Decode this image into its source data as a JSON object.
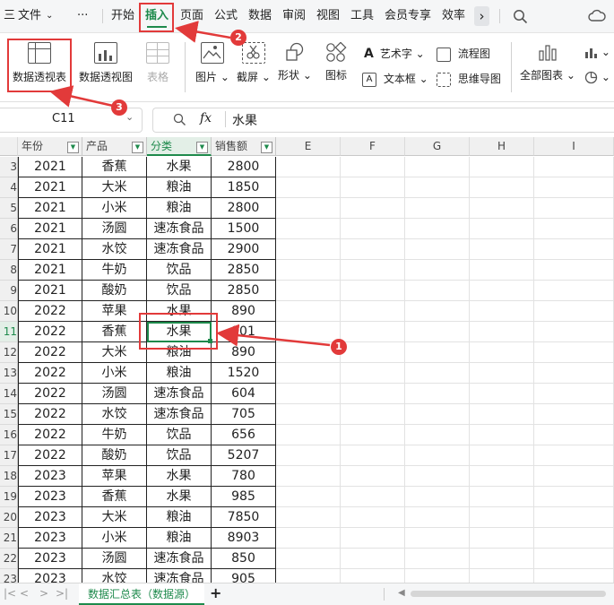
{
  "menu": {
    "hamburger": "三",
    "file": "文件",
    "file_caret": "⌄",
    "more": "···",
    "tabs": [
      "开始",
      "插入",
      "页面",
      "公式",
      "数据",
      "审阅",
      "视图",
      "工具",
      "会员专享",
      "效率"
    ],
    "next_arrow": "›"
  },
  "ribbon": {
    "pivot_table": "数据透视表",
    "pivot_chart": "数据透视图",
    "table": "表格",
    "picture": "图片",
    "screenshot": "截屏",
    "shape": "形状",
    "icon": "图标",
    "wordart": "艺术字",
    "textbox": "文本框",
    "flowchart": "流程图",
    "mindmap": "思维导图",
    "all_charts": "全部图表"
  },
  "formula_bar": {
    "cell_ref": "C11",
    "fx": "fx",
    "value": "水果"
  },
  "columns": {
    "a": "年份",
    "b": "产品",
    "c": "分类",
    "d": "销售额",
    "e": "E",
    "f": "F",
    "g": "G",
    "h": "H",
    "i": "I"
  },
  "rows": [
    {
      "num": "3",
      "year": "2021",
      "product": "香蕉",
      "category": "水果",
      "sales": "2800"
    },
    {
      "num": "4",
      "year": "2021",
      "product": "大米",
      "category": "粮油",
      "sales": "1850"
    },
    {
      "num": "5",
      "year": "2021",
      "product": "小米",
      "category": "粮油",
      "sales": "2800"
    },
    {
      "num": "6",
      "year": "2021",
      "product": "汤圆",
      "category": "速冻食品",
      "sales": "1500"
    },
    {
      "num": "7",
      "year": "2021",
      "product": "水饺",
      "category": "速冻食品",
      "sales": "2900"
    },
    {
      "num": "8",
      "year": "2021",
      "product": "牛奶",
      "category": "饮品",
      "sales": "2850"
    },
    {
      "num": "9",
      "year": "2021",
      "product": "酸奶",
      "category": "饮品",
      "sales": "2850"
    },
    {
      "num": "10",
      "year": "2022",
      "product": "苹果",
      "category": "水果",
      "sales": "890"
    },
    {
      "num": "11",
      "year": "2022",
      "product": "香蕉",
      "category": "水果",
      "sales": "901"
    },
    {
      "num": "12",
      "year": "2022",
      "product": "大米",
      "category": "粮油",
      "sales": "890"
    },
    {
      "num": "13",
      "year": "2022",
      "product": "小米",
      "category": "粮油",
      "sales": "1520"
    },
    {
      "num": "14",
      "year": "2022",
      "product": "汤圆",
      "category": "速冻食品",
      "sales": "604"
    },
    {
      "num": "15",
      "year": "2022",
      "product": "水饺",
      "category": "速冻食品",
      "sales": "705"
    },
    {
      "num": "16",
      "year": "2022",
      "product": "牛奶",
      "category": "饮品",
      "sales": "656"
    },
    {
      "num": "17",
      "year": "2022",
      "product": "酸奶",
      "category": "饮品",
      "sales": "5207"
    },
    {
      "num": "18",
      "year": "2023",
      "product": "苹果",
      "category": "水果",
      "sales": "780"
    },
    {
      "num": "19",
      "year": "2023",
      "product": "香蕉",
      "category": "水果",
      "sales": "985"
    },
    {
      "num": "20",
      "year": "2023",
      "product": "大米",
      "category": "粮油",
      "sales": "7850"
    },
    {
      "num": "21",
      "year": "2023",
      "product": "小米",
      "category": "粮油",
      "sales": "8903"
    },
    {
      "num": "22",
      "year": "2023",
      "product": "汤圆",
      "category": "速冻食品",
      "sales": "850"
    },
    {
      "num": "23",
      "year": "2023",
      "product": "水饺",
      "category": "速冻食品",
      "sales": "905"
    }
  ],
  "selected_row": "11",
  "sheet_tab": "数据汇总表（数据源）",
  "add_sheet": "+",
  "nav": {
    "first": "|<",
    "prev": "<",
    "next": ">",
    "last": ">|"
  },
  "callouts": {
    "one": "1",
    "two": "2",
    "three": "3"
  },
  "colors": {
    "accent": "#1e8a4c",
    "callout": "#e23a3a"
  }
}
